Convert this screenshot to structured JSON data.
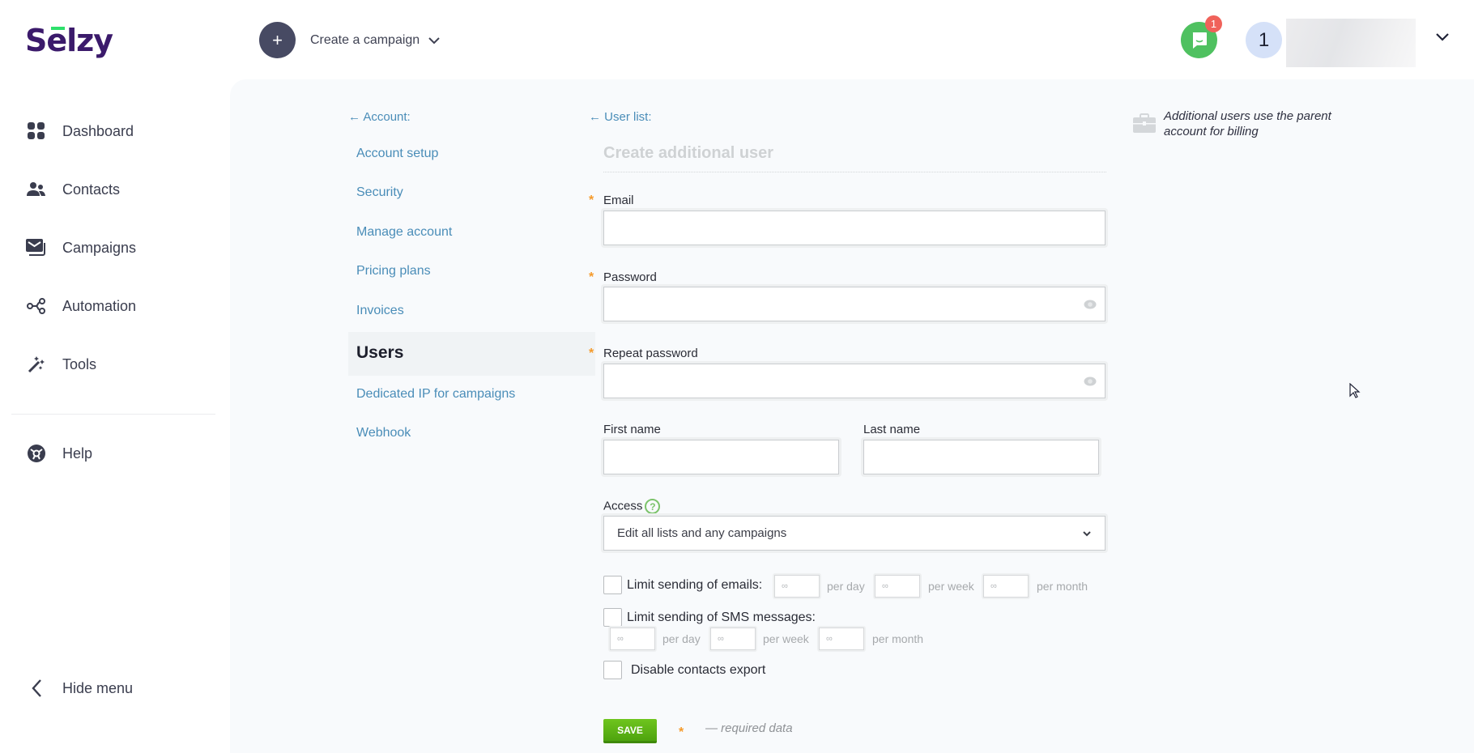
{
  "brand": {
    "logo_text": "Selzy",
    "accent_color": "#2de06b",
    "logo_color": "#3b1a6b"
  },
  "topbar": {
    "create_label": "Create a campaign",
    "chat_badge": "1",
    "avatar_initial": "1"
  },
  "sidebar": {
    "items": [
      {
        "label": "Dashboard",
        "icon": "dashboard-icon"
      },
      {
        "label": "Contacts",
        "icon": "contacts-icon"
      },
      {
        "label": "Campaigns",
        "icon": "campaigns-icon"
      },
      {
        "label": "Automation",
        "icon": "automation-icon"
      },
      {
        "label": "Tools",
        "icon": "tools-icon"
      }
    ],
    "help_label": "Help",
    "hide_menu_label": "Hide menu"
  },
  "subnav": {
    "back_label": "Account:",
    "items": [
      "Account setup",
      "Security",
      "Manage account",
      "Pricing plans",
      "Invoices"
    ],
    "active": "Users",
    "items_after": [
      "Dedicated IP for campaigns",
      "Webhook"
    ]
  },
  "form": {
    "back_label": "User list:",
    "title": "Create additional user",
    "email_label": "Email",
    "email_value": "",
    "password_label": "Password",
    "password_value": "",
    "repeat_password_label": "Repeat password",
    "repeat_password_value": "",
    "first_name_label": "First name",
    "first_name_value": "",
    "last_name_label": "Last name",
    "last_name_value": "",
    "access_label": "Access",
    "access_value": "Edit all lists and any campaigns",
    "limit_emails_label": "Limit sending of emails:",
    "limit_emails_checked": false,
    "limit_sms_label": "Limit sending of SMS messages:",
    "limit_sms_checked": false,
    "disable_export_label": "Disable contacts export",
    "disable_export_checked": false,
    "limit_placeholder": "∞",
    "per_day": "per day",
    "per_week": "per week",
    "per_month": "per month",
    "save_label": "SAVE",
    "required_note": "— required data",
    "required_color": "#f59a2a"
  },
  "billing_note": "Additional users use the parent account for billing"
}
